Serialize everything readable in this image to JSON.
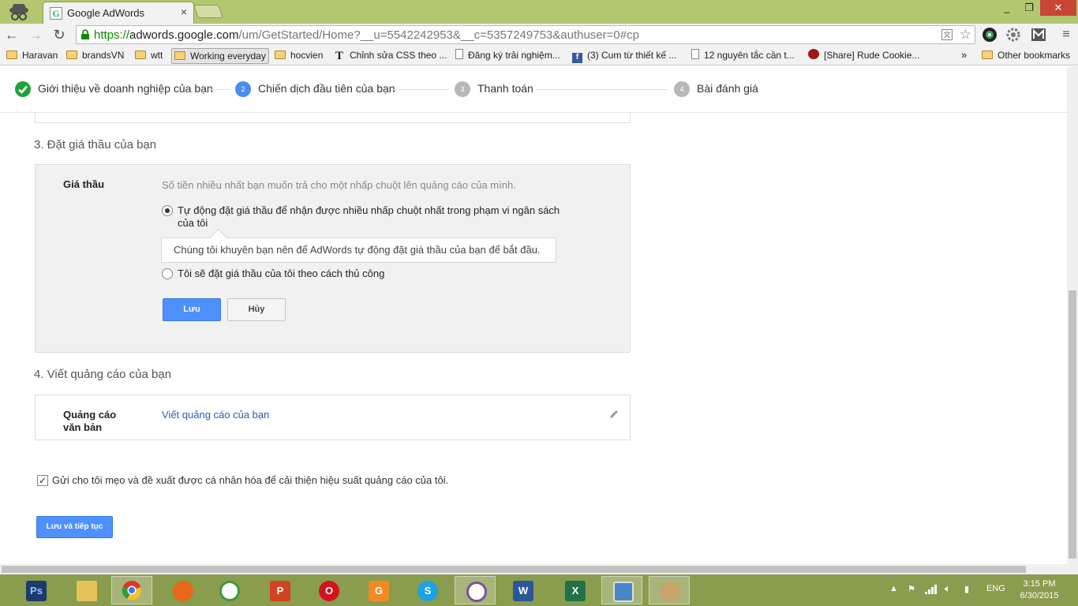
{
  "browser": {
    "tab_title": "Google AdWords",
    "tab_close": "×",
    "favicon_letter": "G",
    "url": {
      "scheme": "https://",
      "host": "adwords.google.com",
      "path": "/um/GetStarted/Home?__u=5542242953&__c=5357249753&authuser=0#cp"
    },
    "bookmarks": [
      "Haravan",
      "brandsVN",
      "wtt",
      "Working everyday",
      "hocvien",
      "Chỉnh sửa CSS theo ...",
      "Đăng ký trải nghiệm...",
      "(3) Cum từ thiết kế ...",
      "12 nguyên tắc cần t...",
      "[Share] Rude Cookie..."
    ],
    "bookmarks_overflow": "»",
    "other_bookmarks": "Other bookmarks"
  },
  "stepper": {
    "steps": [
      {
        "number": "1",
        "label": "Giới thiệu về doanh nghiệp của bạn",
        "state": "done"
      },
      {
        "number": "2",
        "label": "Chiến dịch đầu tiên của bạn",
        "state": "current"
      },
      {
        "number": "3",
        "label": "Thanh toán",
        "state": "future"
      },
      {
        "number": "4",
        "label": "Bài đánh giá",
        "state": "future"
      }
    ]
  },
  "bid_section": {
    "title": "3. Đặt giá thầu của bạn",
    "field_label": "Giá thầu",
    "hint": "Số tiền nhiều nhất bạn muốn trả cho một nhấp chuột lên quảng cáo của mình.",
    "option_auto": "Tự động đặt giá thầu để nhận được nhiều nhấp chuột nhất trong phạm vi ngân sách của tôi",
    "tooltip": "Chúng tôi khuyên bạn nên để AdWords tự động đặt giá thầu của bạn để bắt đầu.",
    "option_manual": "Tôi sẽ đặt giá thầu của tôi theo cách thủ công",
    "save_label": "Lưu",
    "cancel_label": "Hủy"
  },
  "ad_section": {
    "title": "4. Viết quảng cáo của bạn",
    "field_label": "Quảng cáo văn bản",
    "link": "Viết quảng cáo của bạn"
  },
  "tips_checkbox": {
    "label": "Gửi cho tôi mẹo và đề xuất được cá nhân hóa để cải thiện hiệu suất quảng cáo của tôi.",
    "checked": true
  },
  "continue_label": "Lưu và tiếp tục",
  "taskbar": {
    "apps": [
      {
        "name": "photoshop",
        "glyph": "Ps",
        "color": "#1c3a6e"
      },
      {
        "name": "file-explorer",
        "glyph": "",
        "color": "#e6c25a"
      },
      {
        "name": "chrome",
        "glyph": "",
        "color": "#d6382d"
      },
      {
        "name": "firefox",
        "glyph": "",
        "color": "#e8671a"
      },
      {
        "name": "greenshot",
        "glyph": "",
        "color": "#3a9a3a"
      },
      {
        "name": "powerpoint",
        "glyph": "P",
        "color": "#d04423"
      },
      {
        "name": "opera",
        "glyph": "O",
        "color": "#d6111e"
      },
      {
        "name": "foxit-pdf",
        "glyph": "G",
        "color": "#f08a24"
      },
      {
        "name": "skype",
        "glyph": "S",
        "color": "#1da1e2"
      },
      {
        "name": "viber",
        "glyph": "",
        "color": "#7b519d"
      },
      {
        "name": "word",
        "glyph": "W",
        "color": "#2b579a"
      },
      {
        "name": "excel",
        "glyph": "X",
        "color": "#217346"
      },
      {
        "name": "photo-viewer",
        "glyph": "",
        "color": "#4a86c6"
      },
      {
        "name": "paint",
        "glyph": "",
        "color": "#c9a46a"
      }
    ],
    "language": "ENG",
    "time": "3:15 PM",
    "date": "6/30/2015"
  }
}
